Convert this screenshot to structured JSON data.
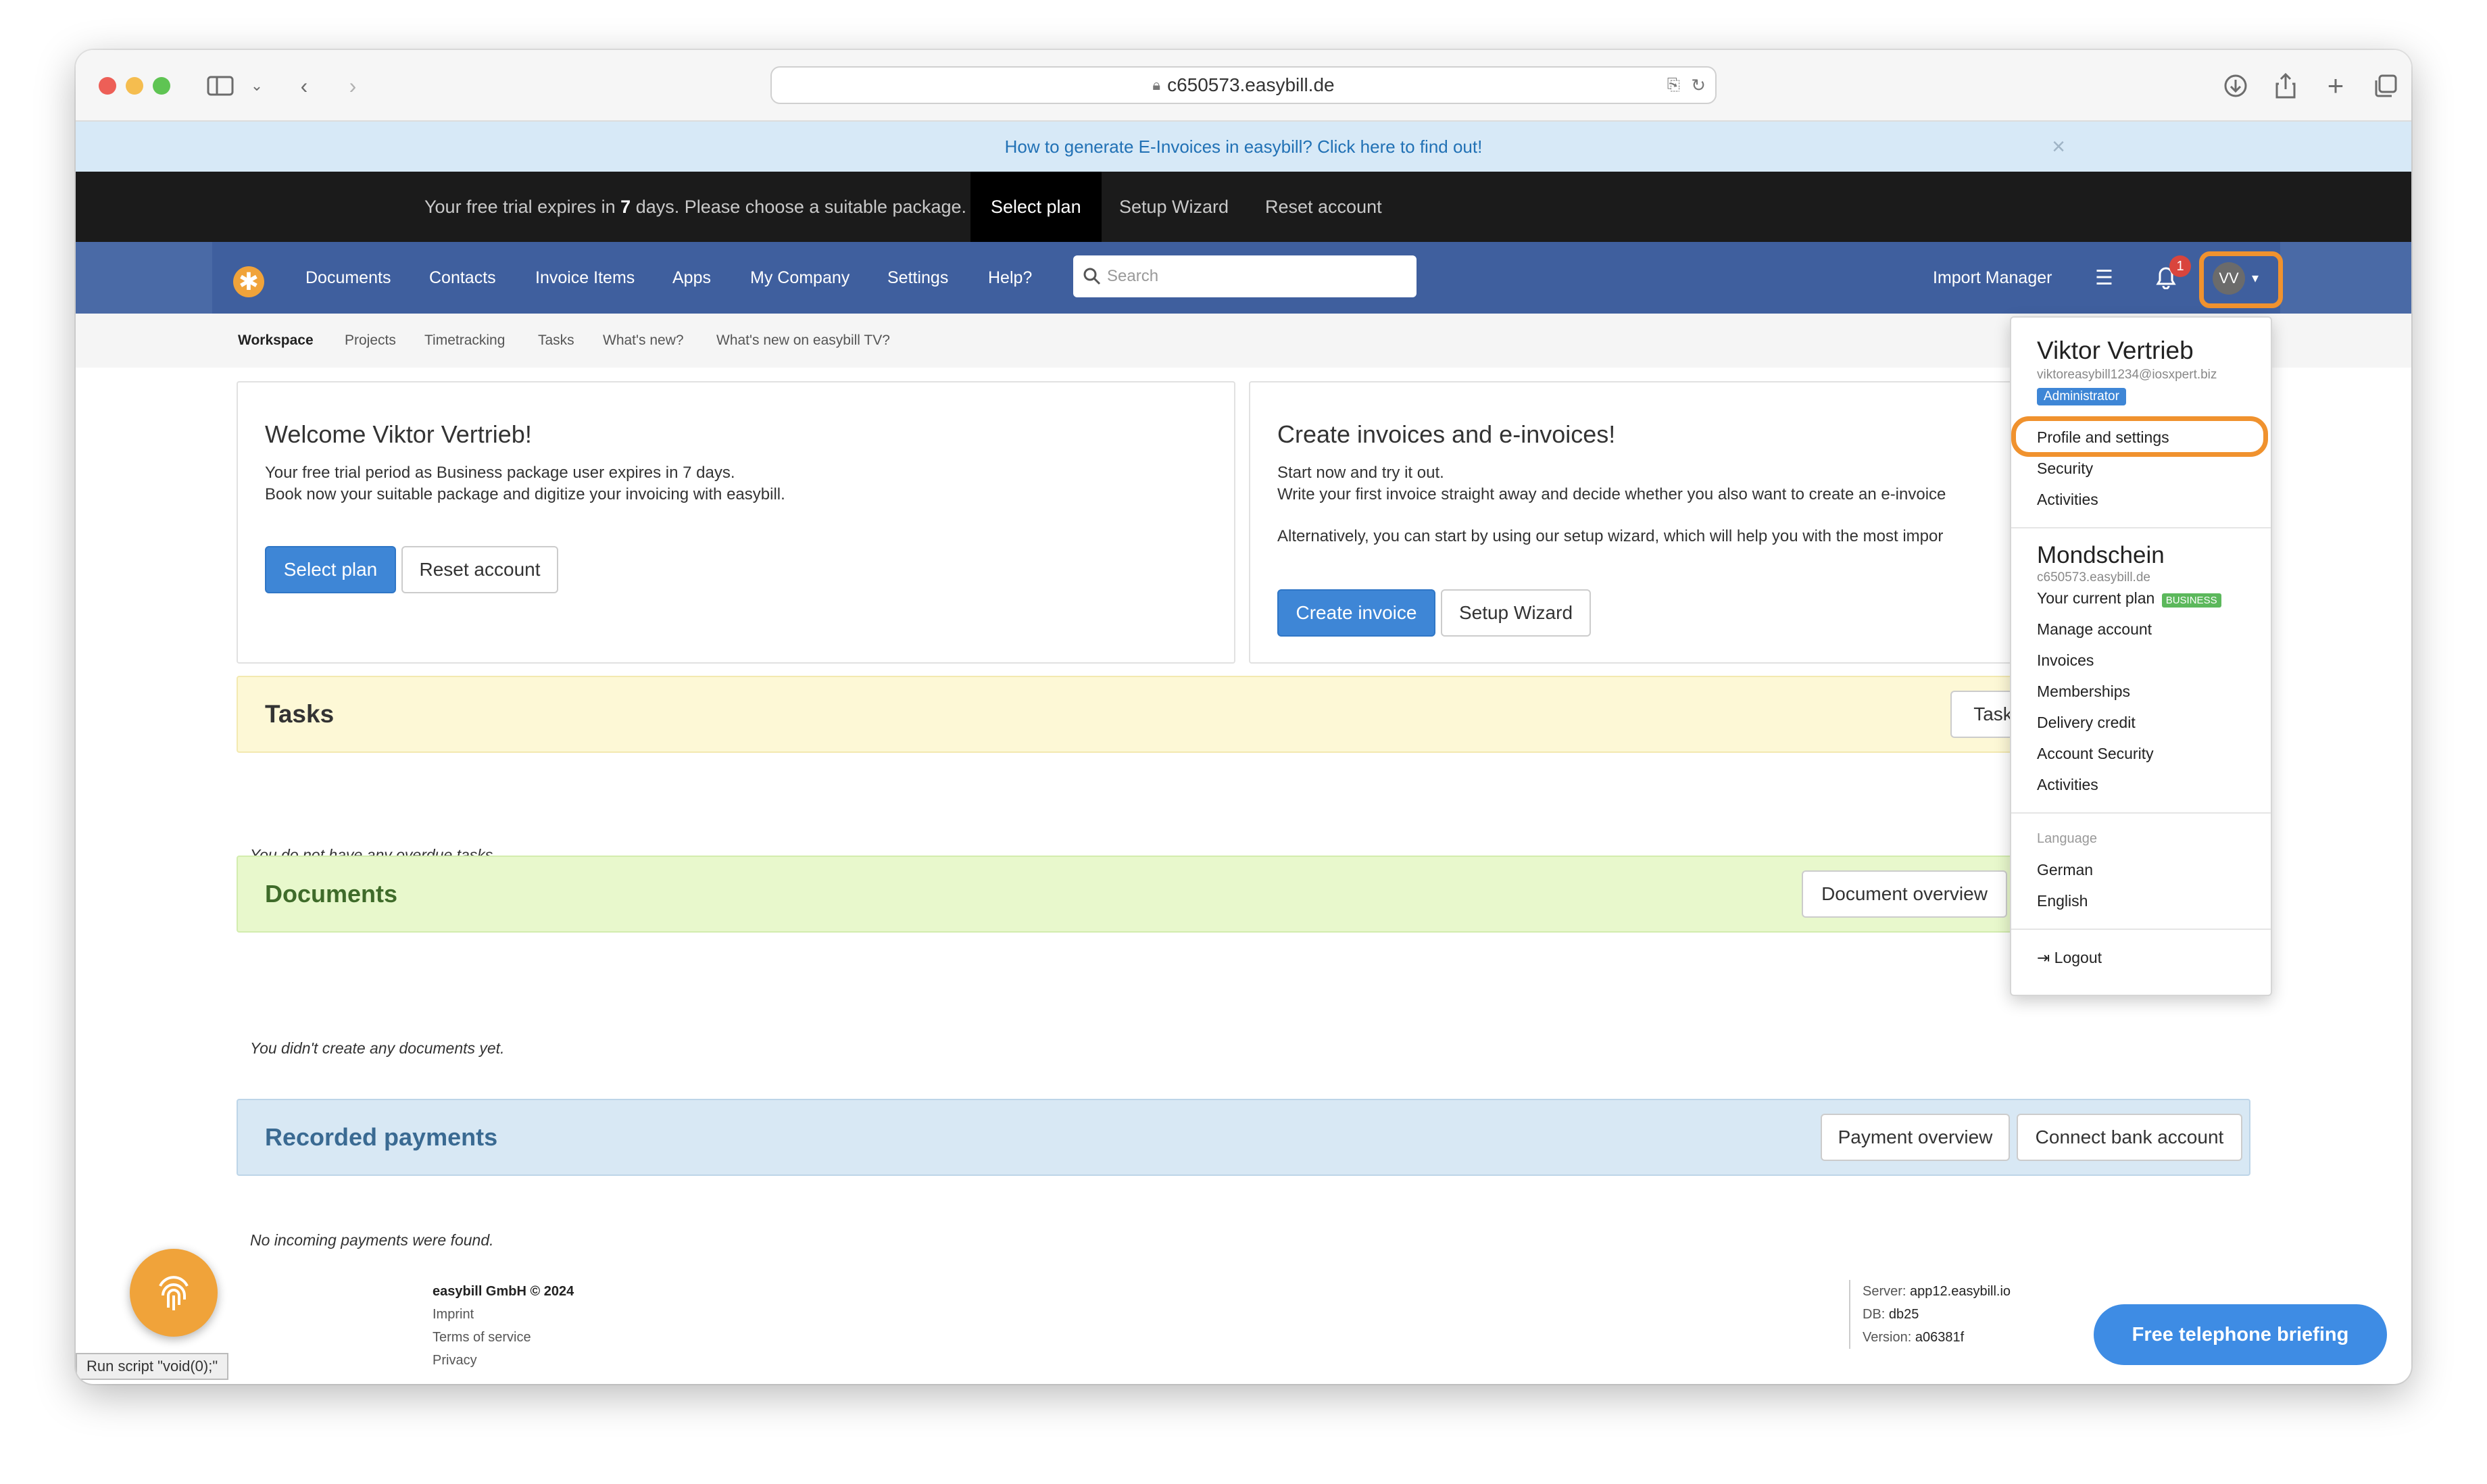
{
  "browser": {
    "url": "c650573.easybill.de"
  },
  "banner": {
    "text": "How to generate E-Invoices in easybill? Click here to find out!",
    "close": "×"
  },
  "trial_bar": {
    "text_pre": "Your free trial expires in",
    "days": "7",
    "text_post": "days. Please choose a suitable package.",
    "select_plan": "Select plan",
    "setup_wizard": "Setup Wizard",
    "reset_account": "Reset account"
  },
  "nav": {
    "items": [
      "Documents",
      "Contacts",
      "Invoice Items",
      "Apps",
      "My Company",
      "Settings",
      "Help?"
    ],
    "search_placeholder": "Search",
    "import_manager": "Import Manager",
    "notification_count": "1",
    "avatar_initials": "VV"
  },
  "subnav": {
    "items": [
      "Workspace",
      "Projects",
      "Timetracking",
      "Tasks",
      "What's new?",
      "What's new on easybill TV?"
    ]
  },
  "welcome": {
    "title": "Welcome Viktor Vertrieb!",
    "line1": "Your free trial period as Business package user expires in 7 days.",
    "line2": "Book now your suitable package and digitize your invoicing with easybill.",
    "select_plan": "Select plan",
    "reset_account": "Reset account"
  },
  "invoices_panel": {
    "title": "Create invoices and e-invoices!",
    "line1": "Start now and try it out.",
    "line2": "Write your first invoice straight away and decide whether you also want to create an e-invoice",
    "line3": "Alternatively, you can start by using our setup wizard, which will help you with the most impor",
    "create_invoice": "Create invoice",
    "setup_wizard": "Setup Wizard"
  },
  "tasks": {
    "title": "Tasks",
    "button": "Tasks",
    "empty": "You do not have any overdue tasks."
  },
  "documents": {
    "title": "Documents",
    "button": "Document overview",
    "empty": "You didn't create any documents yet."
  },
  "payments": {
    "title": "Recorded payments",
    "overview": "Payment overview",
    "connect": "Connect bank account",
    "empty": "No incoming payments were found."
  },
  "user_menu": {
    "name": "Viktor Vertrieb",
    "email": "viktoreasybill1234@iosxpert.biz",
    "role": "Administrator",
    "profile": "Profile and settings",
    "security": "Security",
    "activities": "Activities",
    "company": "Mondschein",
    "domain": "c650573.easybill.de",
    "current_plan": "Your current plan",
    "plan_badge": "BUSINESS",
    "manage_account": "Manage account",
    "invoices": "Invoices",
    "memberships": "Memberships",
    "delivery_credit": "Delivery credit",
    "account_security": "Account Security",
    "activities2": "Activities",
    "language_label": "Language",
    "german": "German",
    "english": "English",
    "logout": "Logout"
  },
  "footer": {
    "company": "easybill GmbH © 2024",
    "imprint": "Imprint",
    "terms": "Terms of service",
    "privacy": "Privacy",
    "server_label": "Server:",
    "server": "app12.easybill.io",
    "db_label": "DB:",
    "db": "db25",
    "version_label": "Version:",
    "version": "a06381f"
  },
  "status_bar": "Run script \"void(0);\"",
  "telephone_button": "Free telephone briefing",
  "colors": {
    "nav": "#3f5f9e",
    "primary": "#3e86d6",
    "highlight": "#f0922e",
    "tasks_bg": "#fdf8d6",
    "documents_bg": "#e8f8cc",
    "payments_bg": "#d8e8f4"
  }
}
